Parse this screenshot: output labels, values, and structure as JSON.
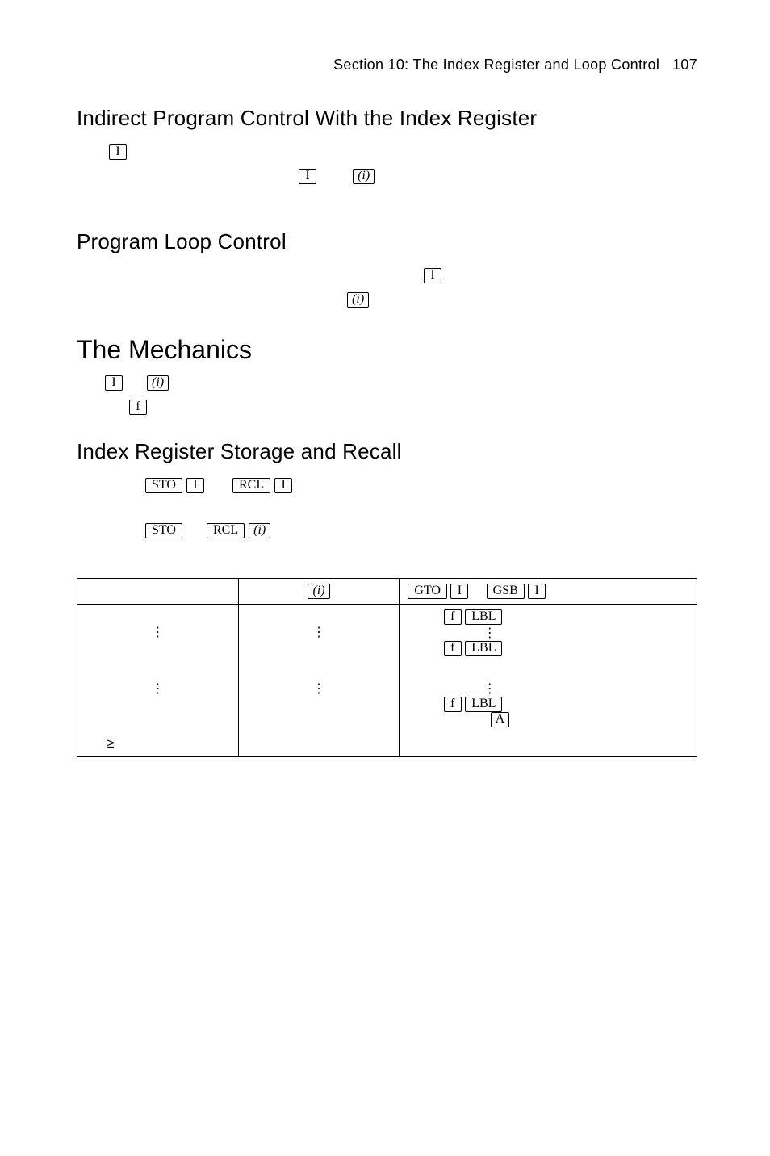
{
  "header": {
    "section": "Section 10: The Index Register and Loop Control",
    "page": "107"
  },
  "keys": {
    "I": "I",
    "i": "(i)",
    "f": "f",
    "STO": "STO",
    "RCL": "RCL",
    "GTO": "GTO",
    "GSB": "GSB",
    "LBL": "LBL",
    "A": "A"
  },
  "headings": {
    "h_indirect": "Indirect Program Control With the Index Register",
    "h_loop": "Program Loop Control",
    "h_mech": "The Mechanics",
    "h_storage": "Index Register Storage and Recall"
  },
  "glyphs": {
    "vdots": "⋮",
    "ge": "≥"
  }
}
